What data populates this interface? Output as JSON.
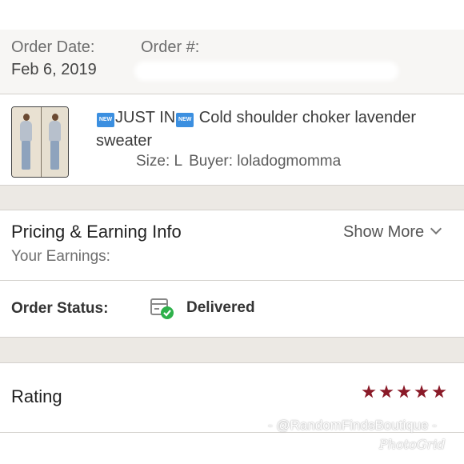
{
  "order": {
    "date_label": "Order Date:",
    "date_value": "Feb 6, 2019",
    "number_label": "Order #:"
  },
  "item": {
    "badge_text": "NEW",
    "title_prefix": "JUST IN",
    "title_main": "Cold shoulder choker lavender sweater",
    "size_text": "Size: L",
    "buyer_text": "Buyer: loladogmomma",
    "badge_color": "#3b8fe0"
  },
  "pricing": {
    "title": "Pricing & Earning Info",
    "show_more": "Show More",
    "earnings_label": "Your Earnings:"
  },
  "status": {
    "label": "Order Status:",
    "value": "Delivered",
    "icon": "package-delivered-icon",
    "check_color": "#2eb14b"
  },
  "rating": {
    "label": "Rating",
    "stars": 5,
    "star_color": "#8a1a28"
  },
  "watermark": {
    "line1": "- @RandomFindsBoutique -",
    "line2": "PhotoGrid"
  }
}
